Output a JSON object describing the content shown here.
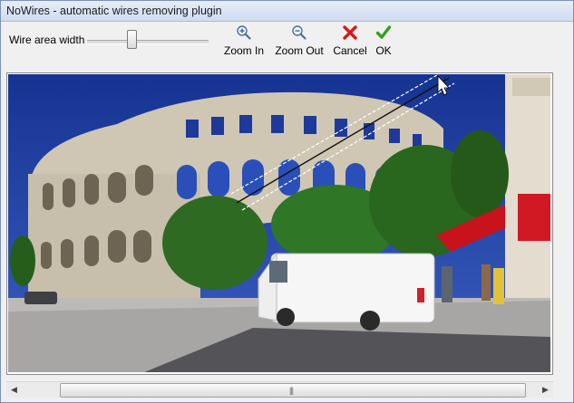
{
  "window": {
    "title": "NoWires - automatic wires removing plugin"
  },
  "toolbar": {
    "wire_area_label": "Wire area width",
    "wire_area_value_fraction": 0.36,
    "zoom_in_label": "Zoom In",
    "zoom_out_label": "Zoom Out",
    "cancel_label": "Cancel",
    "ok_label": "OK"
  },
  "icons": {
    "zoom_in": "zoom-in-icon",
    "zoom_out": "zoom-out-icon",
    "cancel": "cancel-icon",
    "ok": "check-icon"
  },
  "colors": {
    "title_bar": "#d8e4f2",
    "sky": "#1b3b9f",
    "cancel_red": "#d81818",
    "ok_green": "#34a01f",
    "awning_red": "#c8121c"
  },
  "scrollbar": {
    "grip": "|||"
  }
}
